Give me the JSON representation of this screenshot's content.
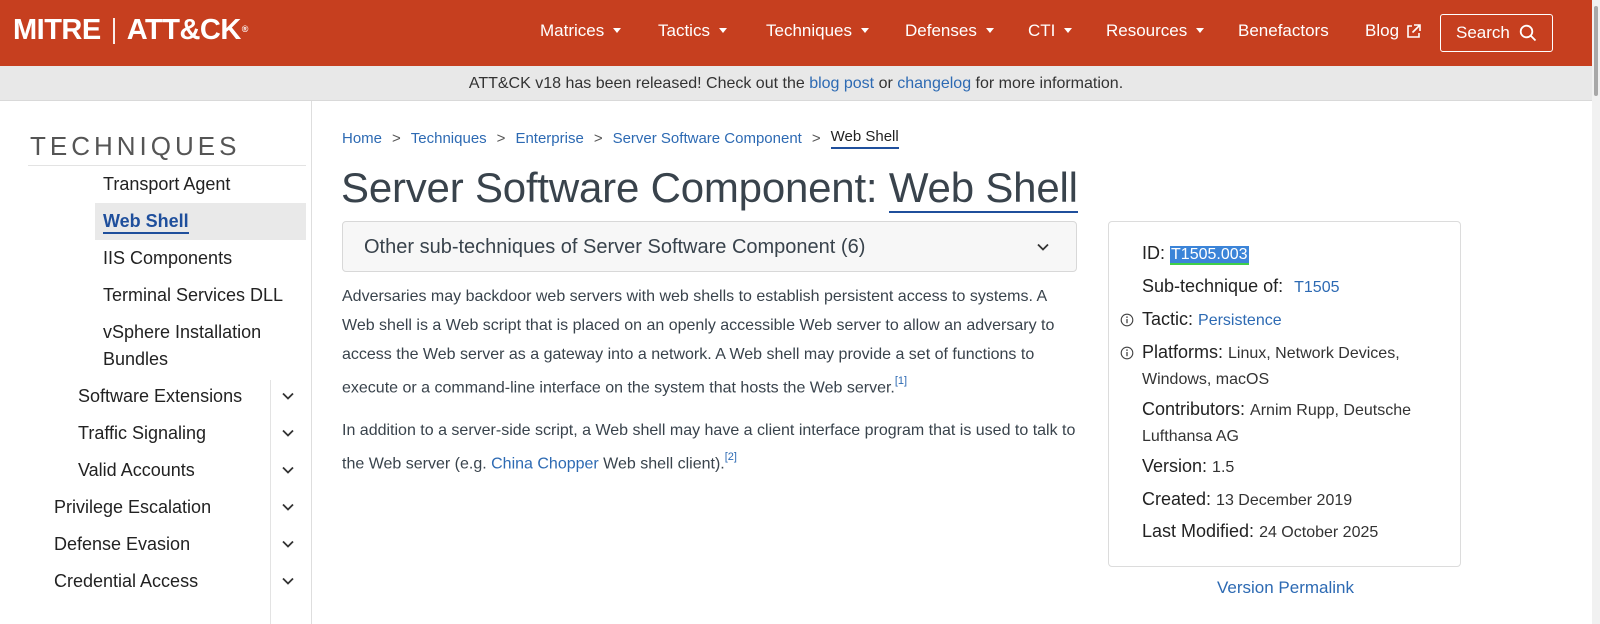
{
  "header": {
    "logo_mitre": "MITRE",
    "logo_attck": "ATT&CK",
    "logo_reg": "®",
    "nav": [
      {
        "label": "Matrices"
      },
      {
        "label": "Tactics"
      },
      {
        "label": "Techniques"
      },
      {
        "label": "Defenses"
      },
      {
        "label": "CTI"
      },
      {
        "label": "Resources"
      },
      {
        "label": "Benefactors"
      },
      {
        "label": "Blog"
      }
    ],
    "search_label": "Search"
  },
  "banner": {
    "text_before": "ATT&CK v18 has been released! Check out the ",
    "link1": "blog post",
    "text_mid": " or ",
    "link2": "changelog",
    "text_after": " for more information."
  },
  "sidebar": {
    "title": "TECHNIQUES",
    "items": [
      {
        "label": "Transport Agent"
      },
      {
        "label": "Web Shell"
      },
      {
        "label": "IIS Components"
      },
      {
        "label": "Terminal Services DLL"
      },
      {
        "label": "vSphere Installation"
      },
      {
        "label": "Bundles"
      },
      {
        "label": "Software Extensions"
      },
      {
        "label": "Traffic Signaling"
      },
      {
        "label": "Valid Accounts"
      },
      {
        "label": "Privilege Escalation"
      },
      {
        "label": "Defense Evasion"
      },
      {
        "label": "Credential Access"
      }
    ]
  },
  "breadcrumb": [
    {
      "label": "Home"
    },
    {
      "label": "Techniques"
    },
    {
      "label": "Enterprise"
    },
    {
      "label": "Server Software Component"
    },
    {
      "label": "Web Shell"
    }
  ],
  "breadcrumb_sep": ">",
  "title": {
    "parent": "Server Software Component: ",
    "sub": "Web Shell"
  },
  "subtechniques_dropdown": "Other sub-techniques of Server Software Component (6)",
  "description": {
    "p1": "Adversaries may backdoor web servers with web shells to establish persistent access to systems. A Web shell is a Web script that is placed on an openly accessible Web server to allow an adversary to access the Web server as a gateway into a network. A Web shell may provide a set of functions to execute or a command-line interface on the system that hosts the Web server.",
    "p1_ref": "[1]",
    "p2_before": "In addition to a server-side script, a Web shell may have a client interface program that is used to talk to the Web server (e.g. ",
    "p2_link": "China Chopper",
    "p2_after": " Web shell client).",
    "p2_ref": "[2]"
  },
  "card": {
    "id_label": "ID: ",
    "id_value": "T1505.003",
    "subtech_label": "Sub-technique of:",
    "subtech_value": "T1505",
    "tactic_label": "Tactic: ",
    "tactic_value": "Persistence",
    "platforms_label": "Platforms: ",
    "platforms_value": "Linux, Network Devices, Windows, macOS",
    "contributors_label": "Contributors: ",
    "contributors_value": "Arnim Rupp, Deutsche Lufthansa AG",
    "version_label": "Version: ",
    "version_value": "1.5",
    "created_label": "Created: ",
    "created_value": "13 December 2019",
    "modified_label": "Last Modified: ",
    "modified_value": "24 October 2025"
  },
  "permalink": "Version Permalink",
  "colors": {
    "brand": "#c63f1f",
    "link": "#2d6ab3",
    "highlight": "#3b84d8"
  }
}
